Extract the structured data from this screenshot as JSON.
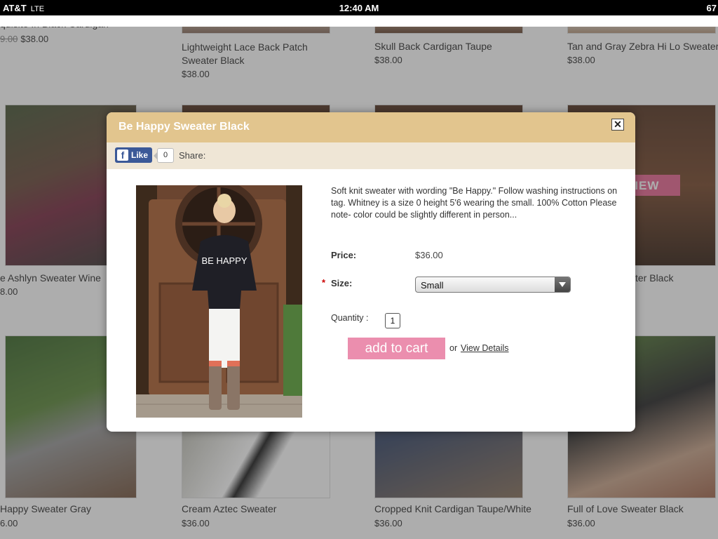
{
  "status_bar": {
    "carrier": "AT&T",
    "network": "LTE",
    "time": "12:40 AM",
    "battery": "67"
  },
  "background_products": {
    "row1": [
      {
        "name": "quisite In Black Cardigan",
        "old_price": "9.00",
        "price": "$38.00"
      },
      {
        "name": "Lightweight Lace Back Patch Sweater Black",
        "price": "$38.00"
      },
      {
        "name": "Skull Back Cardigan Taupe",
        "price": "$38.00"
      },
      {
        "name": "Tan and Gray Zebra Hi Lo Sweater",
        "price": "$38.00"
      }
    ],
    "row2": [
      {
        "name": "e Ashlyn Sweater Wine",
        "price": "8.00"
      },
      {
        "name": "ter Black",
        "price": ""
      }
    ],
    "row3": [
      {
        "name": "Happy Sweater Gray",
        "price": "6.00"
      },
      {
        "name": "Cream Aztec Sweater",
        "price": "$36.00"
      },
      {
        "name": "Cropped Knit Cardigan Taupe/White",
        "price": "$36.00"
      },
      {
        "name": "Full of Love Sweater Black",
        "price": "$36.00"
      }
    ],
    "quick_view_label": "K VIEW"
  },
  "modal": {
    "title": "Be Happy Sweater Black",
    "close_symbol": "✕",
    "social": {
      "like_icon": "f",
      "like_label": "Like",
      "like_count": "0",
      "share_label": "Share:"
    },
    "image_sweater_text": "BE HAPPY",
    "description": "Soft knit sweater with wording \"Be Happy.\" Follow washing instructions on tag. Whitney is a size 0 height 5'6 wearing the small. 100% Cotton Please note- color could be slightly different in person...",
    "price_label": "Price:",
    "price_value": "$36.00",
    "required_mark": "*",
    "size_label": "Size:",
    "size_selected": "Small",
    "quantity_label": "Quantity :",
    "quantity_value": "1",
    "add_to_cart_label": "add to cart",
    "or_text": "or",
    "view_details_label": "View Details"
  }
}
